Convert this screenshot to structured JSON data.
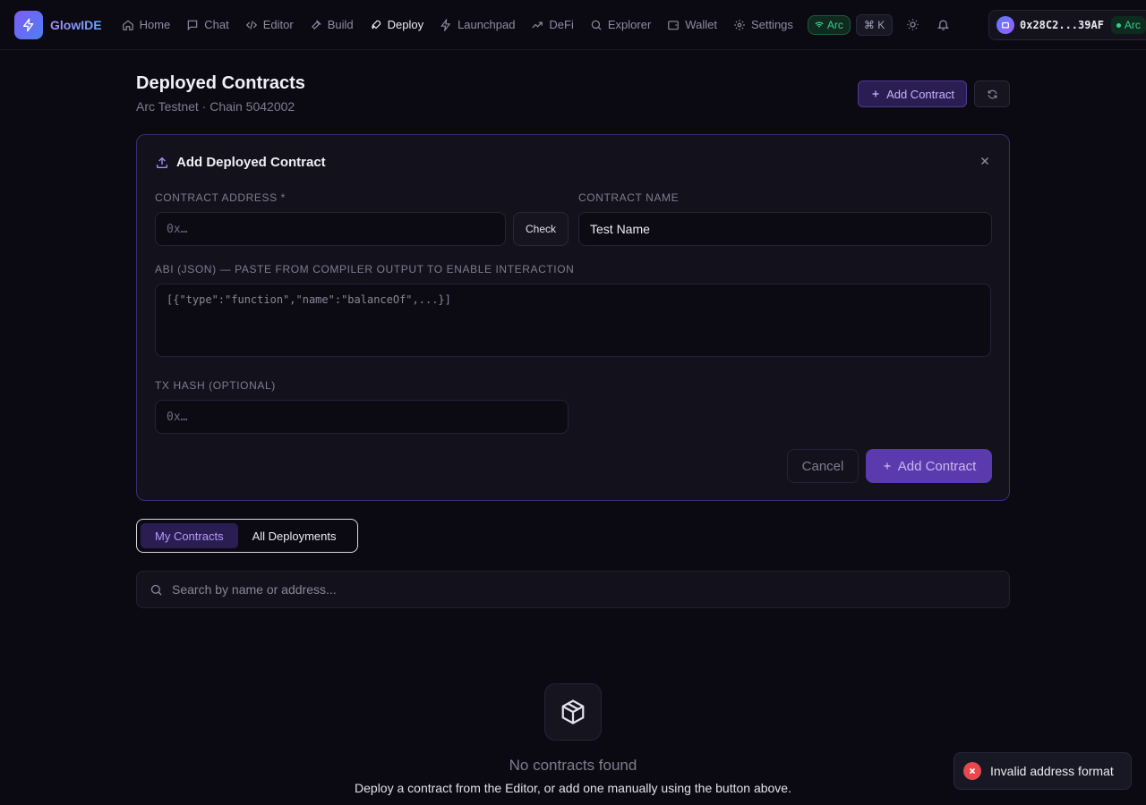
{
  "app": {
    "name": "GlowIDE"
  },
  "nav": {
    "items": [
      {
        "label": "Home",
        "icon": "home-icon"
      },
      {
        "label": "Chat",
        "icon": "chat-icon"
      },
      {
        "label": "Editor",
        "icon": "code-icon"
      },
      {
        "label": "Build",
        "icon": "hammer-icon"
      },
      {
        "label": "Deploy",
        "icon": "rocket-icon",
        "active": true
      },
      {
        "label": "Launchpad",
        "icon": "bolt-icon"
      },
      {
        "label": "DeFi",
        "icon": "trend-icon"
      },
      {
        "label": "Explorer",
        "icon": "search-icon"
      },
      {
        "label": "Wallet",
        "icon": "wallet-icon"
      },
      {
        "label": "Settings",
        "icon": "gear-icon"
      }
    ],
    "network_chip": "Arc",
    "shortcut": "⌘ K"
  },
  "wallet": {
    "address": "0x28C2...39AF",
    "network": "Arc"
  },
  "header": {
    "title": "Deployed Contracts",
    "subtitle": "Arc Testnet · Chain 5042002",
    "add_button": "Add Contract"
  },
  "form": {
    "title": "Add Deployed Contract",
    "address_label": "Contract Address *",
    "address_placeholder": "0x…",
    "check_button": "Check",
    "name_label": "Contract Name",
    "name_value": "Test Name",
    "abi_label": "ABI (JSON) — paste from compiler output to enable interaction",
    "abi_placeholder": "[{\"type\":\"function\",\"name\":\"balanceOf\",...}]",
    "txhash_label": "Tx Hash (optional)",
    "txhash_placeholder": "0x…",
    "cancel_button": "Cancel",
    "submit_button": "Add Contract"
  },
  "tabs": [
    {
      "label": "My Contracts",
      "active": true
    },
    {
      "label": "All Deployments",
      "active": false
    }
  ],
  "search": {
    "placeholder": "Search by name or address..."
  },
  "empty_state": {
    "title": "No contracts found",
    "description": "Deploy a contract from the Editor, or add one manually using the button above."
  },
  "toast": {
    "message": "Invalid address format"
  },
  "colors": {
    "background": "#0b0a12",
    "accent": "#7c5cf5",
    "success": "#39d08a",
    "error": "#e5484d"
  }
}
